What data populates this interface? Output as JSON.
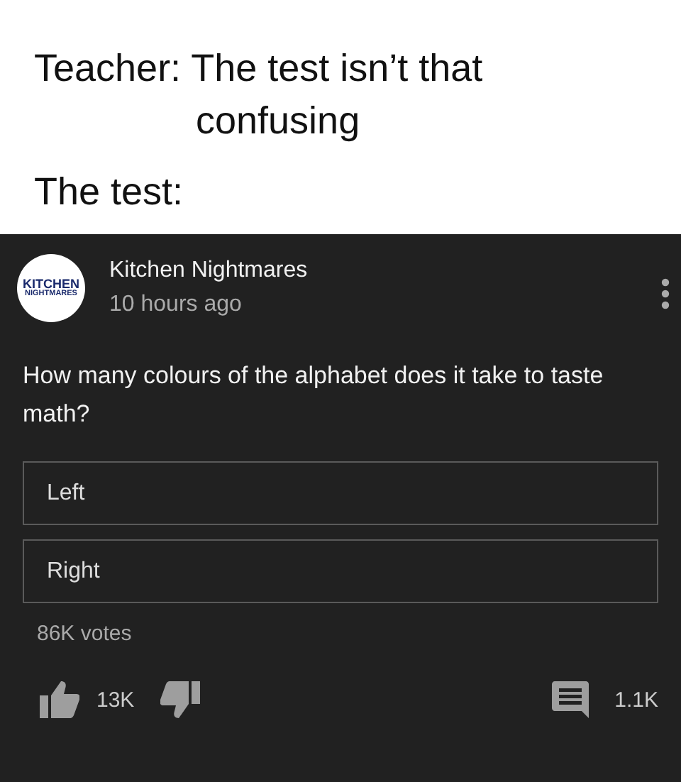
{
  "caption": {
    "lines": [
      "Teacher: The test isn’t that",
      "confusing"
    ],
    "label": "The test:"
  },
  "post": {
    "channel": "Kitchen Nightmares",
    "avatar_lines": [
      "KITCHEN",
      "NIGHTMARES"
    ],
    "time": "10 hours ago",
    "question": "How many colours of the alphabet does it take to taste math?",
    "options": [
      "Left",
      "Right"
    ],
    "votes": "86K votes",
    "likes": "13K",
    "comments": "1.1K"
  }
}
